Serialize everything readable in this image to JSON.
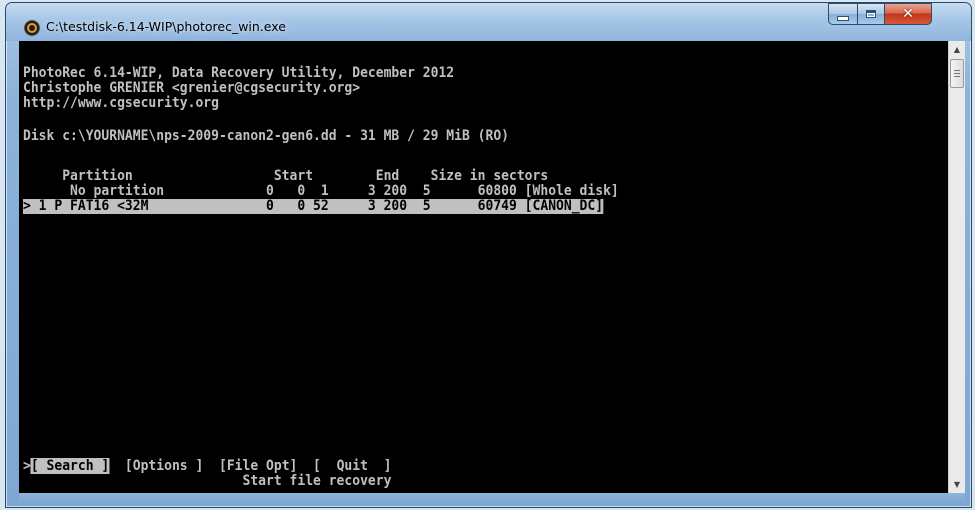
{
  "window": {
    "title": "C:\\testdisk-6.14-WIP\\photorec_win.exe",
    "icon": "photorec-app-icon",
    "controls": {
      "minimize": "minimize-icon",
      "maximize": "maximize-icon",
      "close": "close-icon"
    }
  },
  "console": {
    "header": [
      "PhotoRec 6.14-WIP, Data Recovery Utility, December 2012",
      "Christophe GRENIER <grenier@cgsecurity.org>",
      "http://www.cgsecurity.org"
    ],
    "disk_line": "Disk c:\\YOURNAME\\nps-2009-canon2-gen6.dd - 31 MB / 29 MiB (RO)",
    "table_header": "     Partition                  Start        End    Size in sectors",
    "partitions": [
      {
        "text": "      No partition             0   0  1     3 200  5      60800 [Whole disk]",
        "selected": false
      },
      {
        "text": "> 1 P FAT16 <32M               0   0 52     3 200  5      60749 [CANON_DC]",
        "selected": true
      }
    ],
    "menu": {
      "cursor": ">",
      "search": "[ Search ]",
      "options": "  [Options ]  [File Opt]  [  Quit  ]",
      "hint": "                            Start file recovery"
    }
  }
}
